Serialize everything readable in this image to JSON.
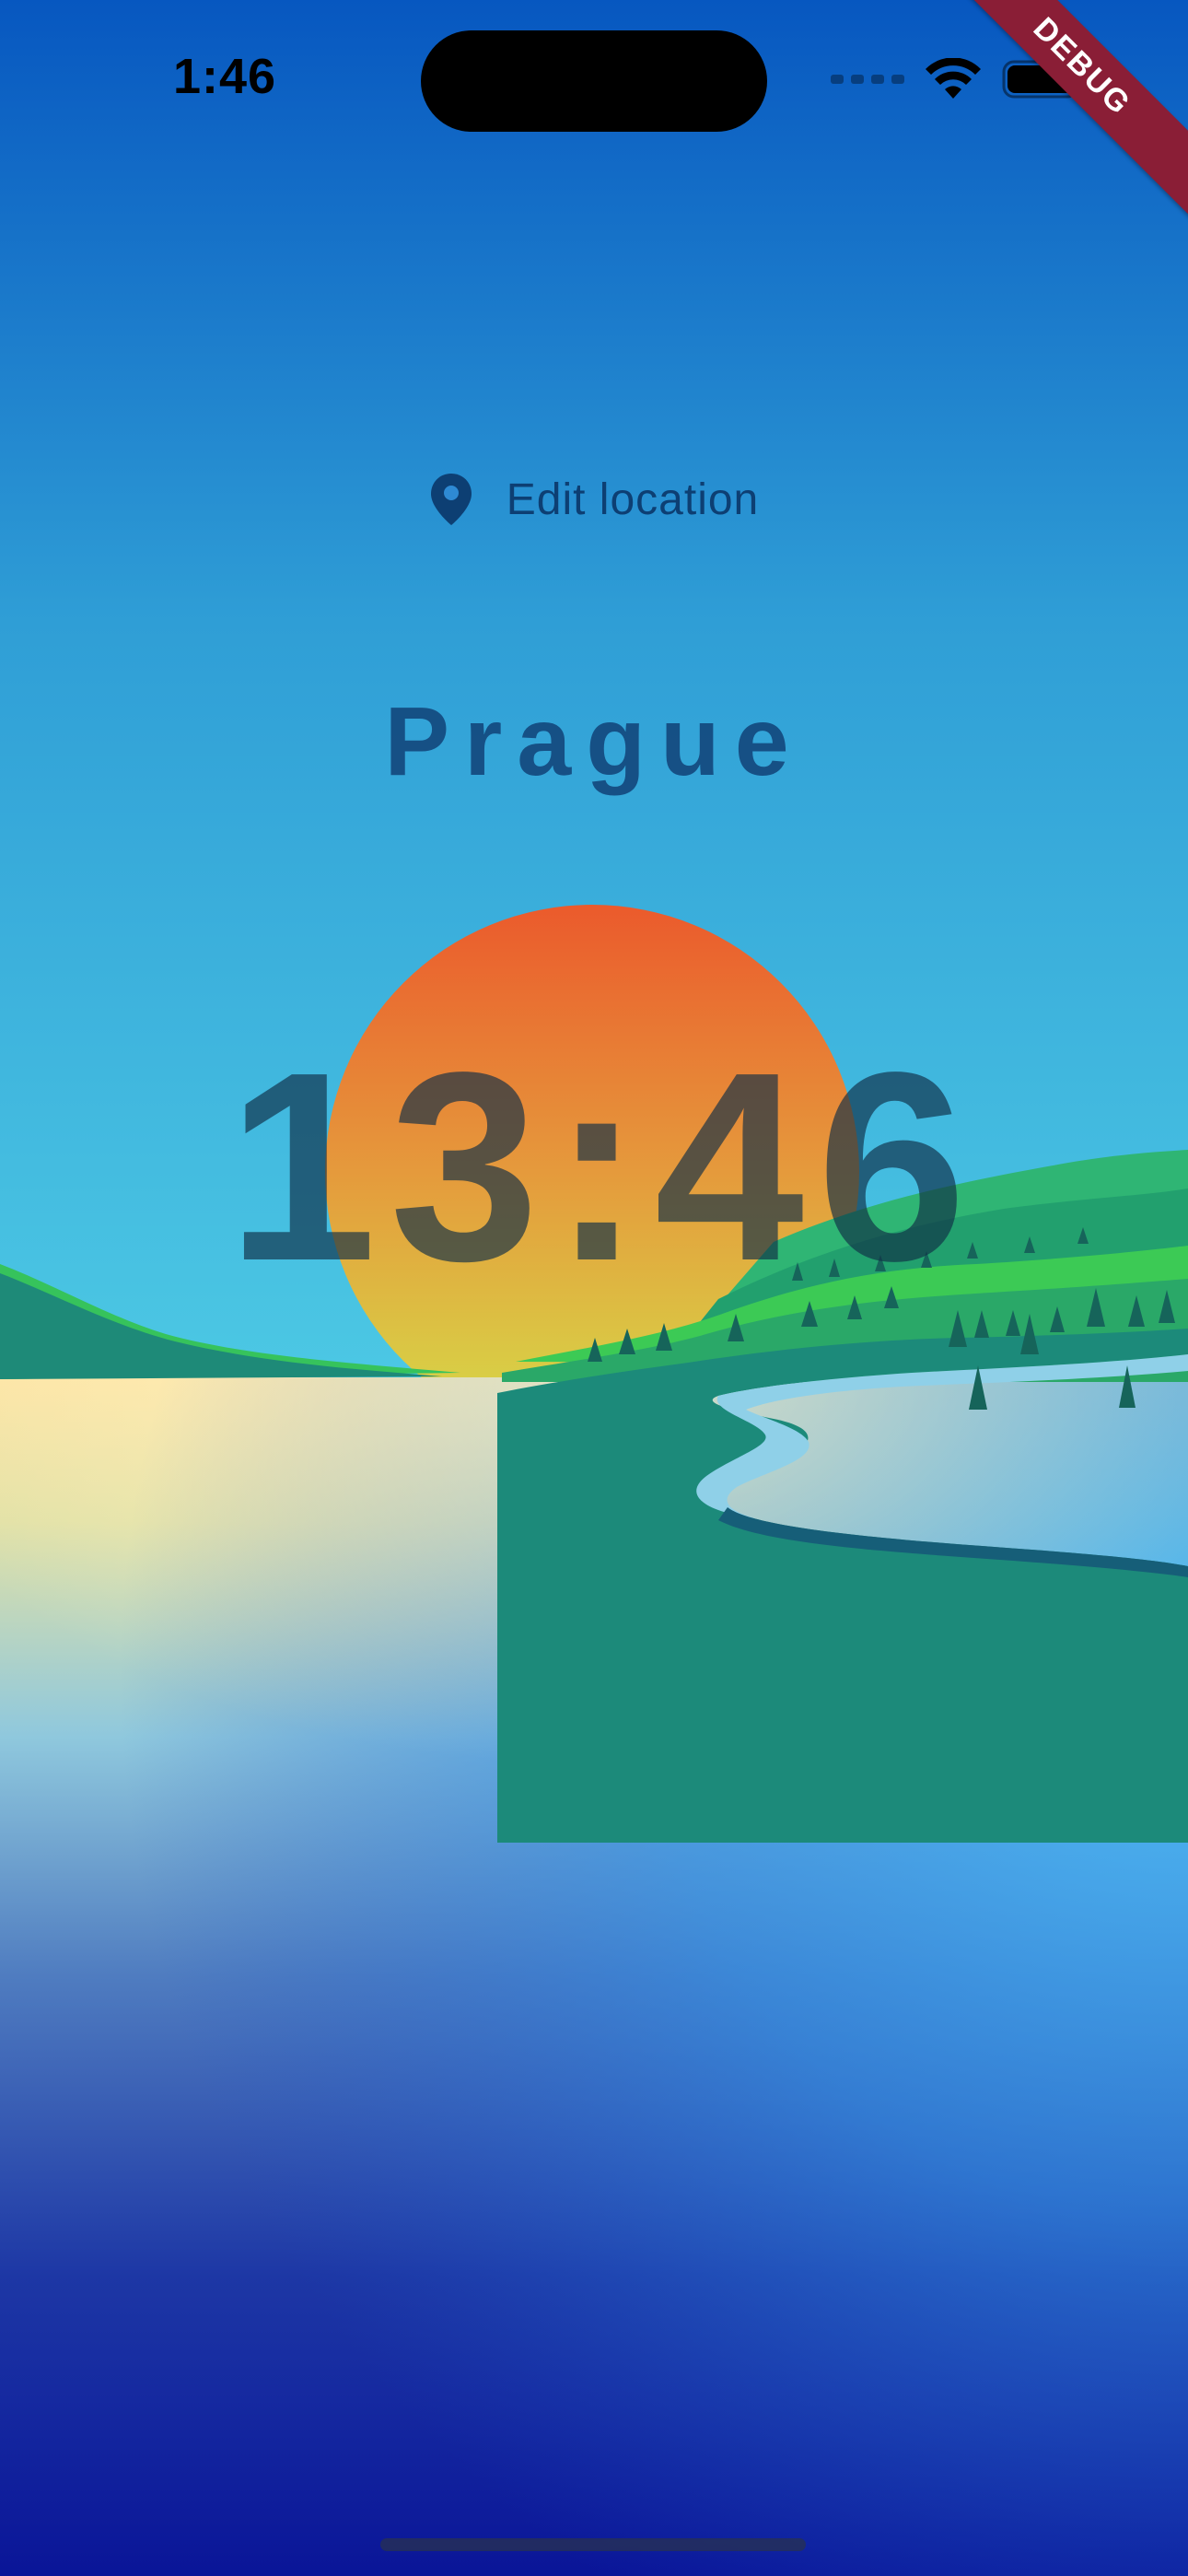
{
  "status_bar": {
    "time": "1:46"
  },
  "debug_banner": "DEBUG",
  "location": {
    "icon": "location-pin-icon",
    "edit_label": "Edit location",
    "city": "Prague"
  },
  "clock": {
    "time": "13:46"
  },
  "colors": {
    "sky_top": "#0a57c2",
    "sky_mid": "#46c2e3",
    "sun_top": "#ea5e2b",
    "sun_bottom": "#d6dc46",
    "hills": "#1d8a78",
    "hills_light": "#35bd72",
    "water_bottom": "#0919a0",
    "debug_ribbon": "#8a1e36"
  }
}
